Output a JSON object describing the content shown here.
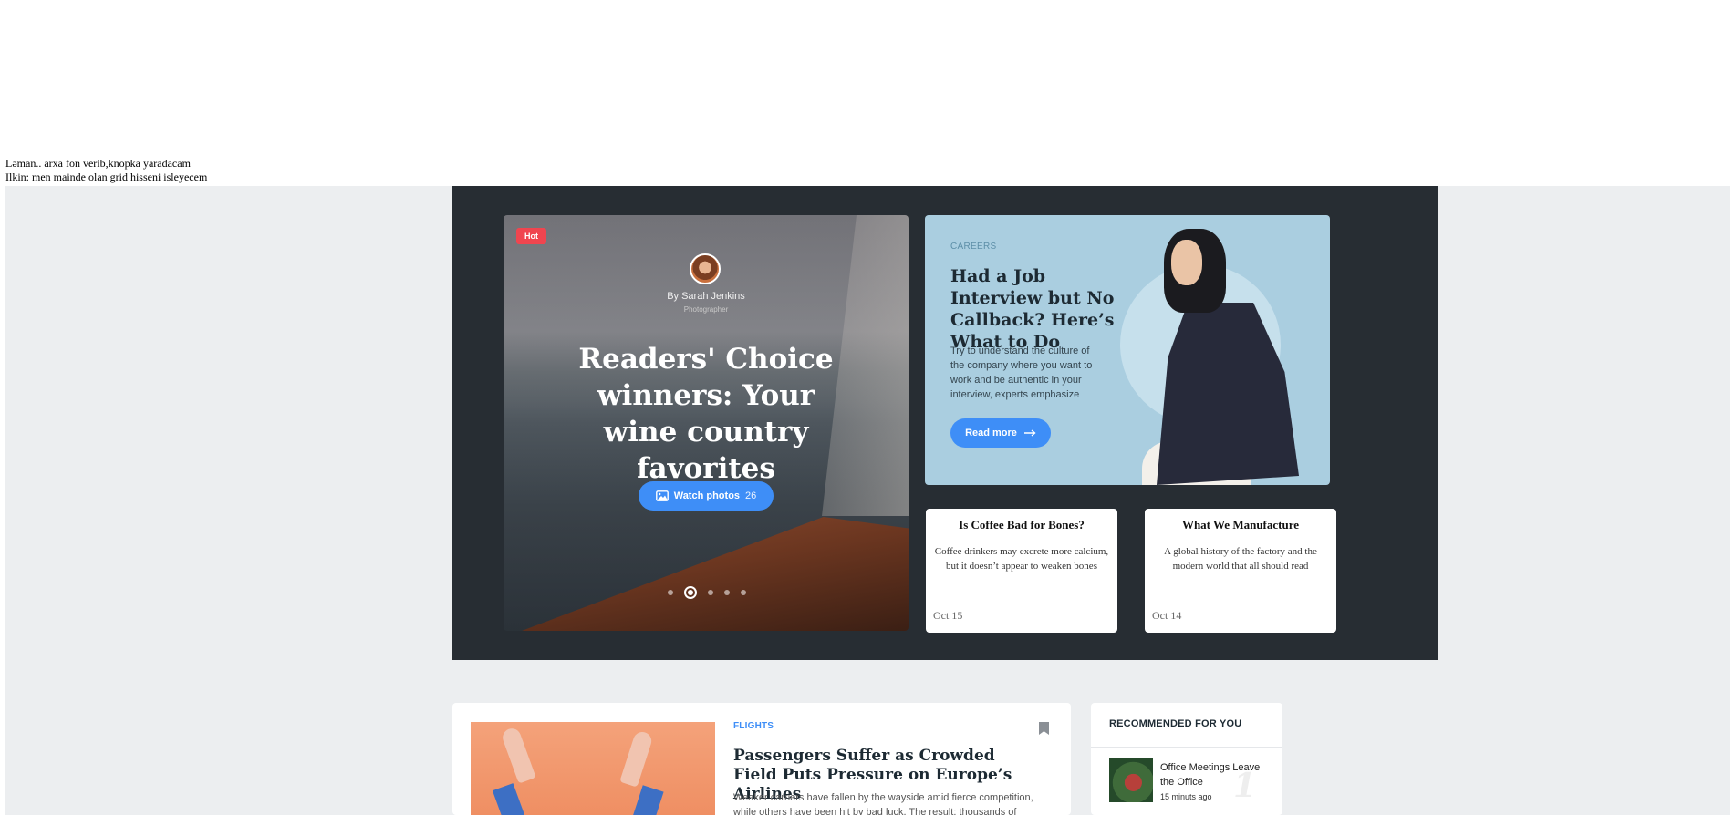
{
  "notes": {
    "line1": "Ləman.. arxa fon verib,knopka yaradacam",
    "line2": "Ilkin: men mainde olan grid hisseni isleyecem"
  },
  "slider": {
    "badge": "Hot",
    "author": "By Sarah Jenkins",
    "author_role": "Photographer",
    "title": "Readers' Choice winners: Your wine country favorites",
    "watch_label": "Watch photos",
    "photo_count": "26",
    "active_slide": 2,
    "slide_count": 5
  },
  "careers": {
    "category": "CAREERS",
    "title": "Had a Job Interview but No Callback? Here’s What to Do",
    "description": "Try to understand the culture of the company where you want to work and be authentic in your interview, experts emphasize",
    "button": "Read more"
  },
  "cards": [
    {
      "title": "Is Coffee Bad for Bones?",
      "description": "Coffee drinkers may excrete more calcium, but it doesn’t appear to weaken bones",
      "date": "Oct 15"
    },
    {
      "title": "What We Manufacture",
      "description": "A global history of the factory and the modern world that all should read",
      "date": "Oct 14"
    }
  ],
  "article": {
    "category": "FLIGHTS",
    "title": "Passengers Suffer as Crowded Field Puts Pressure on Europe’s Airlines",
    "description": "Weaker carriers have fallen by the wayside amid fierce competition, while others have been hit by bad luck. The result: thousands of"
  },
  "recommended": {
    "heading": "RECOMMENDED FOR YOU",
    "items": [
      {
        "title": "Office Meetings Leave the Office",
        "time": "15 minuts ago",
        "number": "1"
      }
    ]
  },
  "colors": {
    "accent": "#3e8ef7",
    "hot": "#f0454f",
    "hero_bg": "#272d33",
    "careers_bg": "#aacee0",
    "page_bg": "#eceef0"
  }
}
